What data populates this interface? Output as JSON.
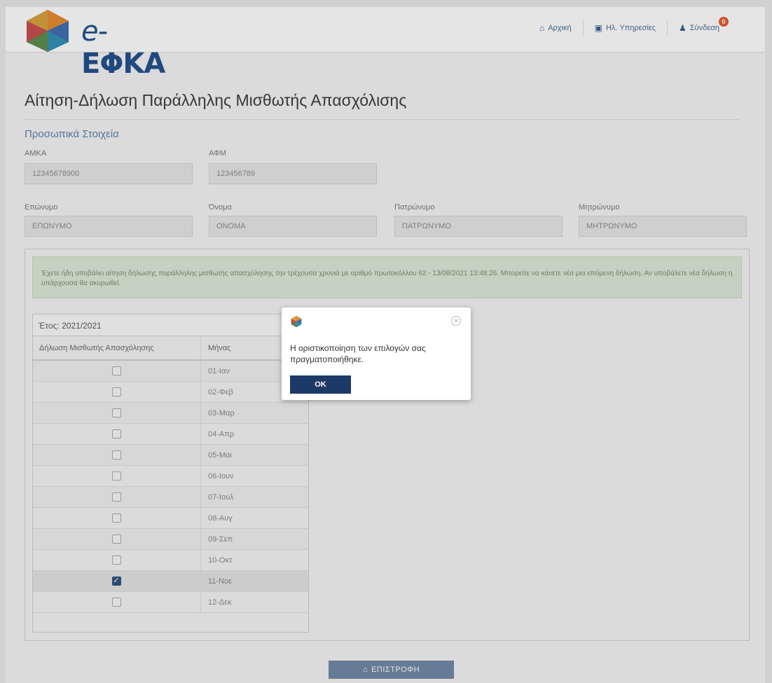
{
  "header": {
    "logo_text_e": "e-",
    "logo_text": "ΕΦΚΑ",
    "nav": [
      {
        "label": "Αρχική",
        "icon": "home-icon"
      },
      {
        "label": "Ηλ. Υπηρεσίες",
        "icon": "services-icon"
      },
      {
        "label": "Σύνδεση",
        "icon": "user-icon",
        "badge": "0"
      }
    ]
  },
  "page": {
    "title": "Αίτηση-Δήλωση Παράλληλης Μισθωτής Απασχόλισης",
    "section": "Προσωπικά Στοιχεία"
  },
  "personal": {
    "amka_label": "ΑΜΚΑ",
    "amka_value": "12345678900",
    "afm_label": "ΑΦΜ",
    "afm_value": "123456789",
    "surname_label": "Επώνυμο",
    "surname_value": "ΕΠΩΝΥΜΟ",
    "name_label": "Όνομα",
    "name_value": "ΟΝΟΜΑ",
    "father_label": "Πατρώνυμο",
    "father_value": "ΠΑΤΡΩΝΥΜΟ",
    "mother_label": "Μητρώνυμο",
    "mother_value": "ΜΗΤΡΩΝΥΜΟ"
  },
  "alert": {
    "text": "Έχετε ήδη υποβάλει αίτηση δήλωσης παράλληλης μισθωτής απασχόλησης την τρέχουσα χρονιά με αριθμό πρωτοκόλλου 62 - 13/08/2021 13:48:26. Μπορείτε να κάνετε νέα μια επόμενη δήλωση. Αν υποβάλετε νέα δήλωση η υπάρχουσα θα ακυρωθεί."
  },
  "table": {
    "year_label": "Έτος: 2021/2021",
    "col1": "Δήλωση Μισθωτής Απασχόλησης",
    "col2": "Μήνας",
    "rows": [
      {
        "month": "01-Ιαν",
        "checked": false
      },
      {
        "month": "02-Φεβ",
        "checked": false
      },
      {
        "month": "03-Μαρ",
        "checked": false
      },
      {
        "month": "04-Απρ",
        "checked": false
      },
      {
        "month": "05-Μαι",
        "checked": false
      },
      {
        "month": "06-Ιουν",
        "checked": false
      },
      {
        "month": "07-Ιουλ",
        "checked": false
      },
      {
        "month": "08-Αυγ",
        "checked": false
      },
      {
        "month": "09-Σεπ",
        "checked": false
      },
      {
        "month": "10-Οκτ",
        "checked": false
      },
      {
        "month": "11-Νοε",
        "checked": true
      },
      {
        "month": "12-Δεκ",
        "checked": false
      }
    ]
  },
  "footer": {
    "return_label": "ΕΠΙΣΤΡΟΦΗ"
  },
  "modal": {
    "message": "Η οριστικοποίηση των επιλογών σας πραγματοποιήθηκε.",
    "ok_label": "OK"
  }
}
